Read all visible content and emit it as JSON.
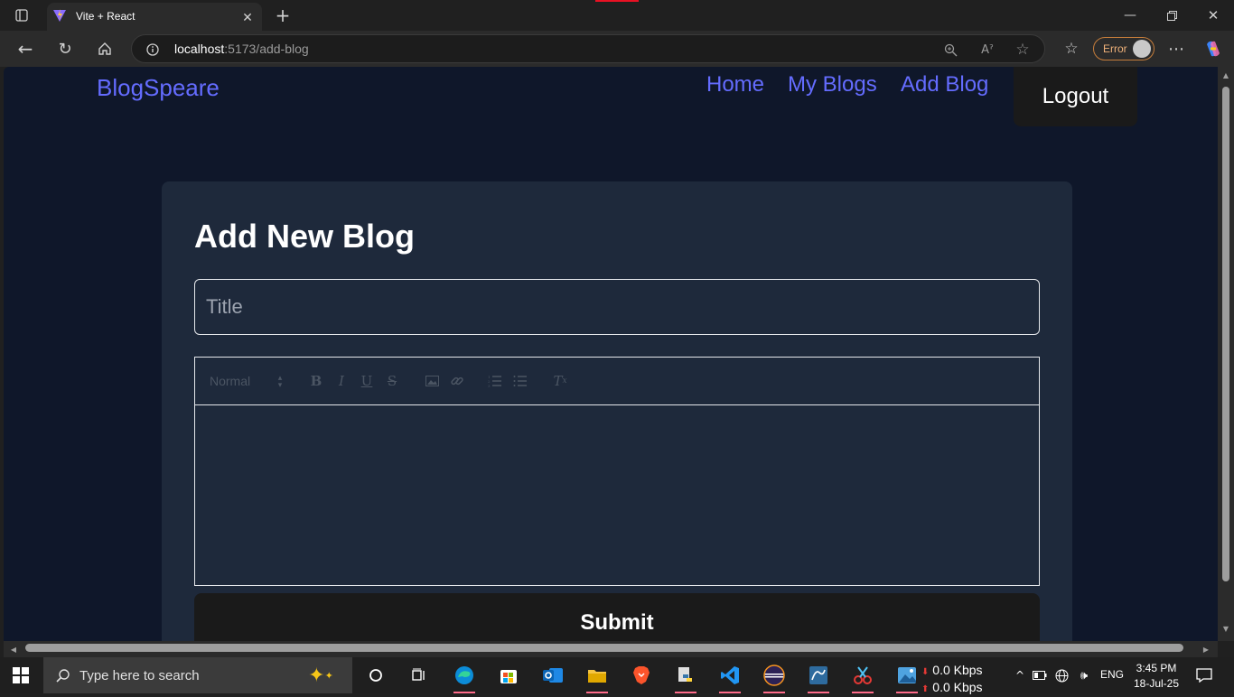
{
  "browser": {
    "tab_title": "Vite + React",
    "url_host": "localhost",
    "url_path": ":5173/add-blog",
    "profile_label": "Error"
  },
  "app": {
    "brand": "BlogSpeare",
    "nav": {
      "home": "Home",
      "my_blogs": "My Blogs",
      "add_blog": "Add Blog"
    },
    "logout": "Logout",
    "form": {
      "heading": "Add New Blog",
      "title_placeholder": "Title",
      "title_value": "",
      "editor": {
        "header_select": "Normal",
        "tools": [
          "bold",
          "italic",
          "underline",
          "strike",
          "image",
          "link",
          "ordered-list",
          "bullet-list",
          "clean"
        ],
        "content": ""
      },
      "submit": "Submit"
    },
    "colors": {
      "background": "#0f172a",
      "card": "#1e293b",
      "accent": "#646cff",
      "button": "#1a1a1a"
    }
  },
  "taskbar": {
    "search_placeholder": "Type here to search",
    "net_down": "0.0 Kbps",
    "net_up": "0.0 Kbps",
    "lang": "ENG",
    "time": "3:45 PM",
    "date": "18-Jul-25",
    "apps": [
      "task-view",
      "edge",
      "microsoft-store",
      "outlook",
      "file-explorer",
      "brave",
      "python",
      "vscode",
      "eclipse",
      "mysql-workbench",
      "snipping-tool",
      "photos"
    ]
  }
}
